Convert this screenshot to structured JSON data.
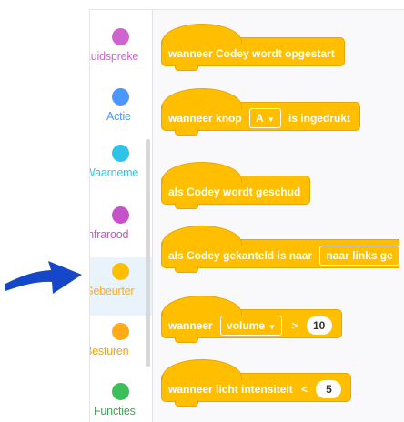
{
  "sidebar": {
    "categories": [
      {
        "label": "Luidspreke",
        "dot_color": "#cf63cf",
        "label_color": "#cf63cf",
        "active": false
      },
      {
        "label": "Actie",
        "dot_color": "#4c97ff",
        "label_color": "#4c97ff",
        "active": false
      },
      {
        "label": "Waarneme",
        "dot_color": "#2ec4e8",
        "label_color": "#2ec4e8",
        "active": false
      },
      {
        "label": "Infrarood",
        "dot_color": "#c751c8",
        "label_color": "#c751c8",
        "active": false
      },
      {
        "label": "Gebeurter",
        "dot_color": "#ffbf00",
        "label_color": "#ffab19",
        "active": true
      },
      {
        "label": "Besturen",
        "dot_color": "#ffab19",
        "label_color": "#ff9f00",
        "active": false
      },
      {
        "label": "Functies",
        "dot_color": "#3bbf58",
        "label_color": "#2fae4a",
        "active": false
      }
    ]
  },
  "blocks": {
    "b1": {
      "text": "wanneer Codey wordt opgestart"
    },
    "b2": {
      "text1": "wanneer knop",
      "dropdown": "A",
      "text2": "is ingedrukt"
    },
    "b3": {
      "text": "als Codey wordt geschud"
    },
    "b4": {
      "text1": "als Codey gekanteld is naar",
      "dropdown": "naar links ge"
    },
    "b5": {
      "text1": "wanneer",
      "dropdown": "volume",
      "operator": ">",
      "value": "10"
    },
    "b6": {
      "text1": "wanneer licht intensiteit",
      "operator": "<",
      "value": "5"
    }
  },
  "colors": {
    "event_block": "#ffbf00",
    "pointer_arrow": "#1747c9"
  }
}
